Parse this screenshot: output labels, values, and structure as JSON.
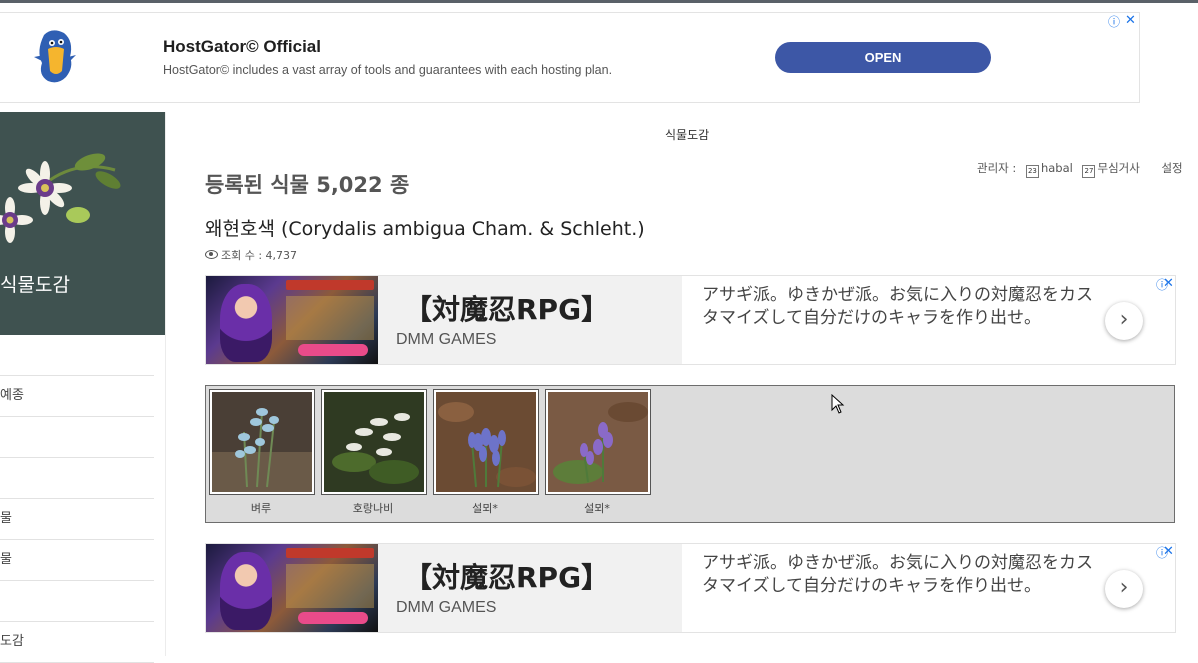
{
  "top_ad": {
    "title": "HostGator© Official",
    "description": "HostGator© includes a vast array of tools and guarantees with each hosting plan.",
    "cta": "OPEN",
    "info_icon": "ⓘ",
    "close_icon": "✕"
  },
  "sidebar": {
    "site_title": "식물도감",
    "menu": [
      "",
      "예종",
      "",
      "",
      "물",
      "물",
      "",
      "도감"
    ]
  },
  "main": {
    "category": "식물도감",
    "admin_label": "관리자 :",
    "admin_level": "23",
    "admin_name": "habal",
    "admin2_level": "27",
    "admin2_name": "무심거사",
    "settings": "설정",
    "registered": "등록된 식물 5,022 종",
    "plant_title": "왜현호색 (Corydalis ambigua Cham. & Schleht.)",
    "views": "조회 수 : 4,737"
  },
  "mid_ad": {
    "title": "【対魔忍RPG】",
    "subtitle": "DMM GAMES",
    "text": "アサギ派。ゆきかぜ派。お気に入りの対魔忍をカスタマイズして自分だけのキャラを作り出せ。",
    "arrow": "›",
    "info_icon": "ⓘ",
    "close_icon": "✕"
  },
  "gallery": {
    "items": [
      {
        "caption": "벼루"
      },
      {
        "caption": "호랑나비"
      },
      {
        "caption": "설뫼*"
      },
      {
        "caption": "설뫼*"
      }
    ]
  },
  "colors": {
    "sidebar_bg": "#3f5250",
    "open_button": "#3d57a6",
    "gallery_bg": "#dcdcdc",
    "ad_link": "#1a73e8"
  }
}
